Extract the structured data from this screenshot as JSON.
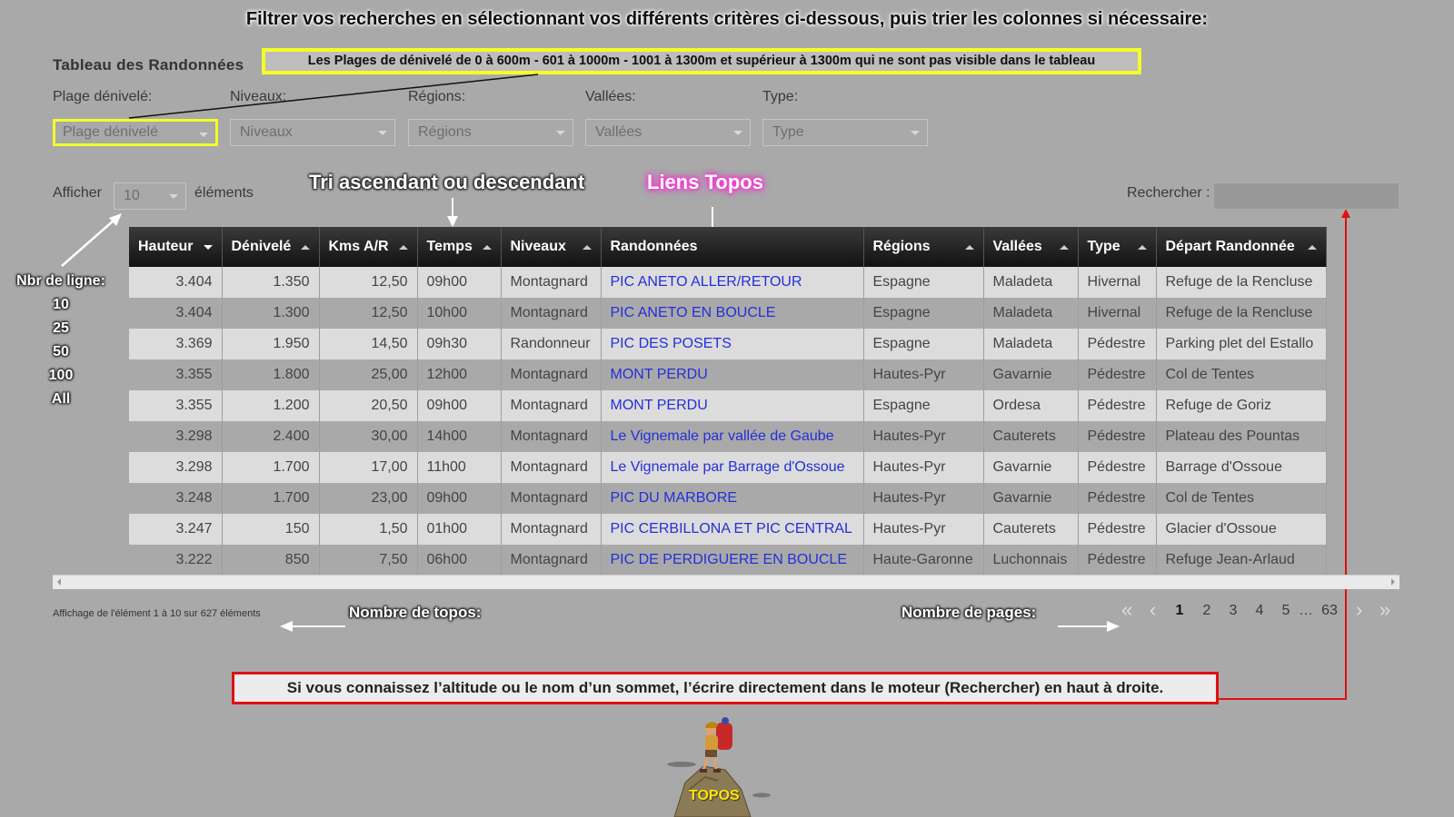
{
  "top_instruction": "Filtrer vos recherches en sélectionnant vos différents critères ci-dessous, puis trier les colonnes si nécessaire:",
  "table_title": "Tableau des Randonnées",
  "yellow_note": "Les Plages de dénivelé de 0 à 600m - 601 à 1000m - 1001 à 1300m et supérieur à 1300m qui ne sont pas visible dans le tableau",
  "filters": [
    {
      "label": "Plage dénivelé:",
      "placeholder": "Plage dénivelé"
    },
    {
      "label": "Niveaux:",
      "placeholder": "Niveaux"
    },
    {
      "label": "Régions:",
      "placeholder": "Régions"
    },
    {
      "label": "Vallées:",
      "placeholder": "Vallées"
    },
    {
      "label": "Type:",
      "placeholder": "Type"
    }
  ],
  "length": {
    "prefix": "Afficher",
    "value": "10",
    "suffix": "éléments"
  },
  "search": {
    "label": "Rechercher :",
    "value": ""
  },
  "annotations": {
    "tri": "Tri ascendant ou descendant",
    "liens": "Liens Topos",
    "nbr_ligne": [
      "Nbr de ligne:",
      "10",
      "25",
      "50",
      "100",
      "All"
    ],
    "nombre_topos": "Nombre de topos:",
    "nombre_pages": "Nombre de pages:"
  },
  "table": {
    "columns": [
      "Hauteur",
      "Dénivelé",
      "Kms A/R",
      "Temps",
      "Niveaux",
      "Randonnées",
      "Régions",
      "Vallées",
      "Type",
      "Départ Randonnée"
    ],
    "rows": [
      [
        "3.404",
        "1.350",
        "12,50",
        "09h00",
        "Montagnard",
        "PIC ANETO ALLER/RETOUR",
        "Espagne",
        "Maladeta",
        "Hivernal",
        "Refuge de la Rencluse"
      ],
      [
        "3.404",
        "1.300",
        "12,50",
        "10h00",
        "Montagnard",
        "PIC ANETO EN BOUCLE",
        "Espagne",
        "Maladeta",
        "Hivernal",
        "Refuge de la Rencluse"
      ],
      [
        "3.369",
        "1.950",
        "14,50",
        "09h30",
        "Randonneur",
        "PIC DES POSETS",
        "Espagne",
        "Maladeta",
        "Pédestre",
        "Parking plet del Estallo"
      ],
      [
        "3.355",
        "1.800",
        "25,00",
        "12h00",
        "Montagnard",
        "MONT PERDU",
        "Hautes-Pyr",
        "Gavarnie",
        "Pédestre",
        "Col de Tentes"
      ],
      [
        "3.355",
        "1.200",
        "20,50",
        "09h00",
        "Montagnard",
        "MONT PERDU",
        "Espagne",
        "Ordesa",
        "Pédestre",
        "Refuge de Goriz"
      ],
      [
        "3.298",
        "2.400",
        "30,00",
        "14h00",
        "Montagnard",
        "Le Vignemale par vallée de Gaube",
        "Hautes-Pyr",
        "Cauterets",
        "Pédestre",
        "Plateau des Pountas"
      ],
      [
        "3.298",
        "1.700",
        "17,00",
        "11h00",
        "Montagnard",
        "Le Vignemale par Barrage d'Ossoue",
        "Hautes-Pyr",
        "Gavarnie",
        "Pédestre",
        "Barrage d'Ossoue"
      ],
      [
        "3.248",
        "1.700",
        "23,00",
        "09h00",
        "Montagnard",
        "PIC DU MARBORE",
        "Hautes-Pyr",
        "Gavarnie",
        "Pédestre",
        "Col de Tentes"
      ],
      [
        "3.247",
        "150",
        "1,50",
        "01h00",
        "Montagnard",
        "PIC CERBILLONA ET PIC CENTRAL",
        "Hautes-Pyr",
        "Cauterets",
        "Pédestre",
        "Glacier d'Ossoue"
      ],
      [
        "3.222",
        "850",
        "7,50",
        "06h00",
        "Montagnard",
        "PIC DE PERDIGUERE EN BOUCLE",
        "Haute-Garonne",
        "Luchonnais",
        "Pédestre",
        "Refuge Jean-Arlaud"
      ]
    ]
  },
  "info": "Affichage de l'élément 1 à 10 sur 627 éléments",
  "pagination": {
    "first": "«",
    "prev": "‹",
    "pages": [
      "1",
      "2",
      "3",
      "4",
      "5"
    ],
    "ellipsis": "…",
    "last_page": "63",
    "next": "›",
    "last": "»"
  },
  "red_note": "Si vous connaissez l’altitude ou le nom d’un sommet, l’écrire directement dans le moteur (Rechercher) en haut à droite.",
  "logo_text": "TOPOS",
  "colors": {
    "highlight_yellow": "#f3ff26",
    "note_red": "#e01010",
    "link_blue": "#2330d8",
    "liens_pink": "#ff2bd6"
  }
}
